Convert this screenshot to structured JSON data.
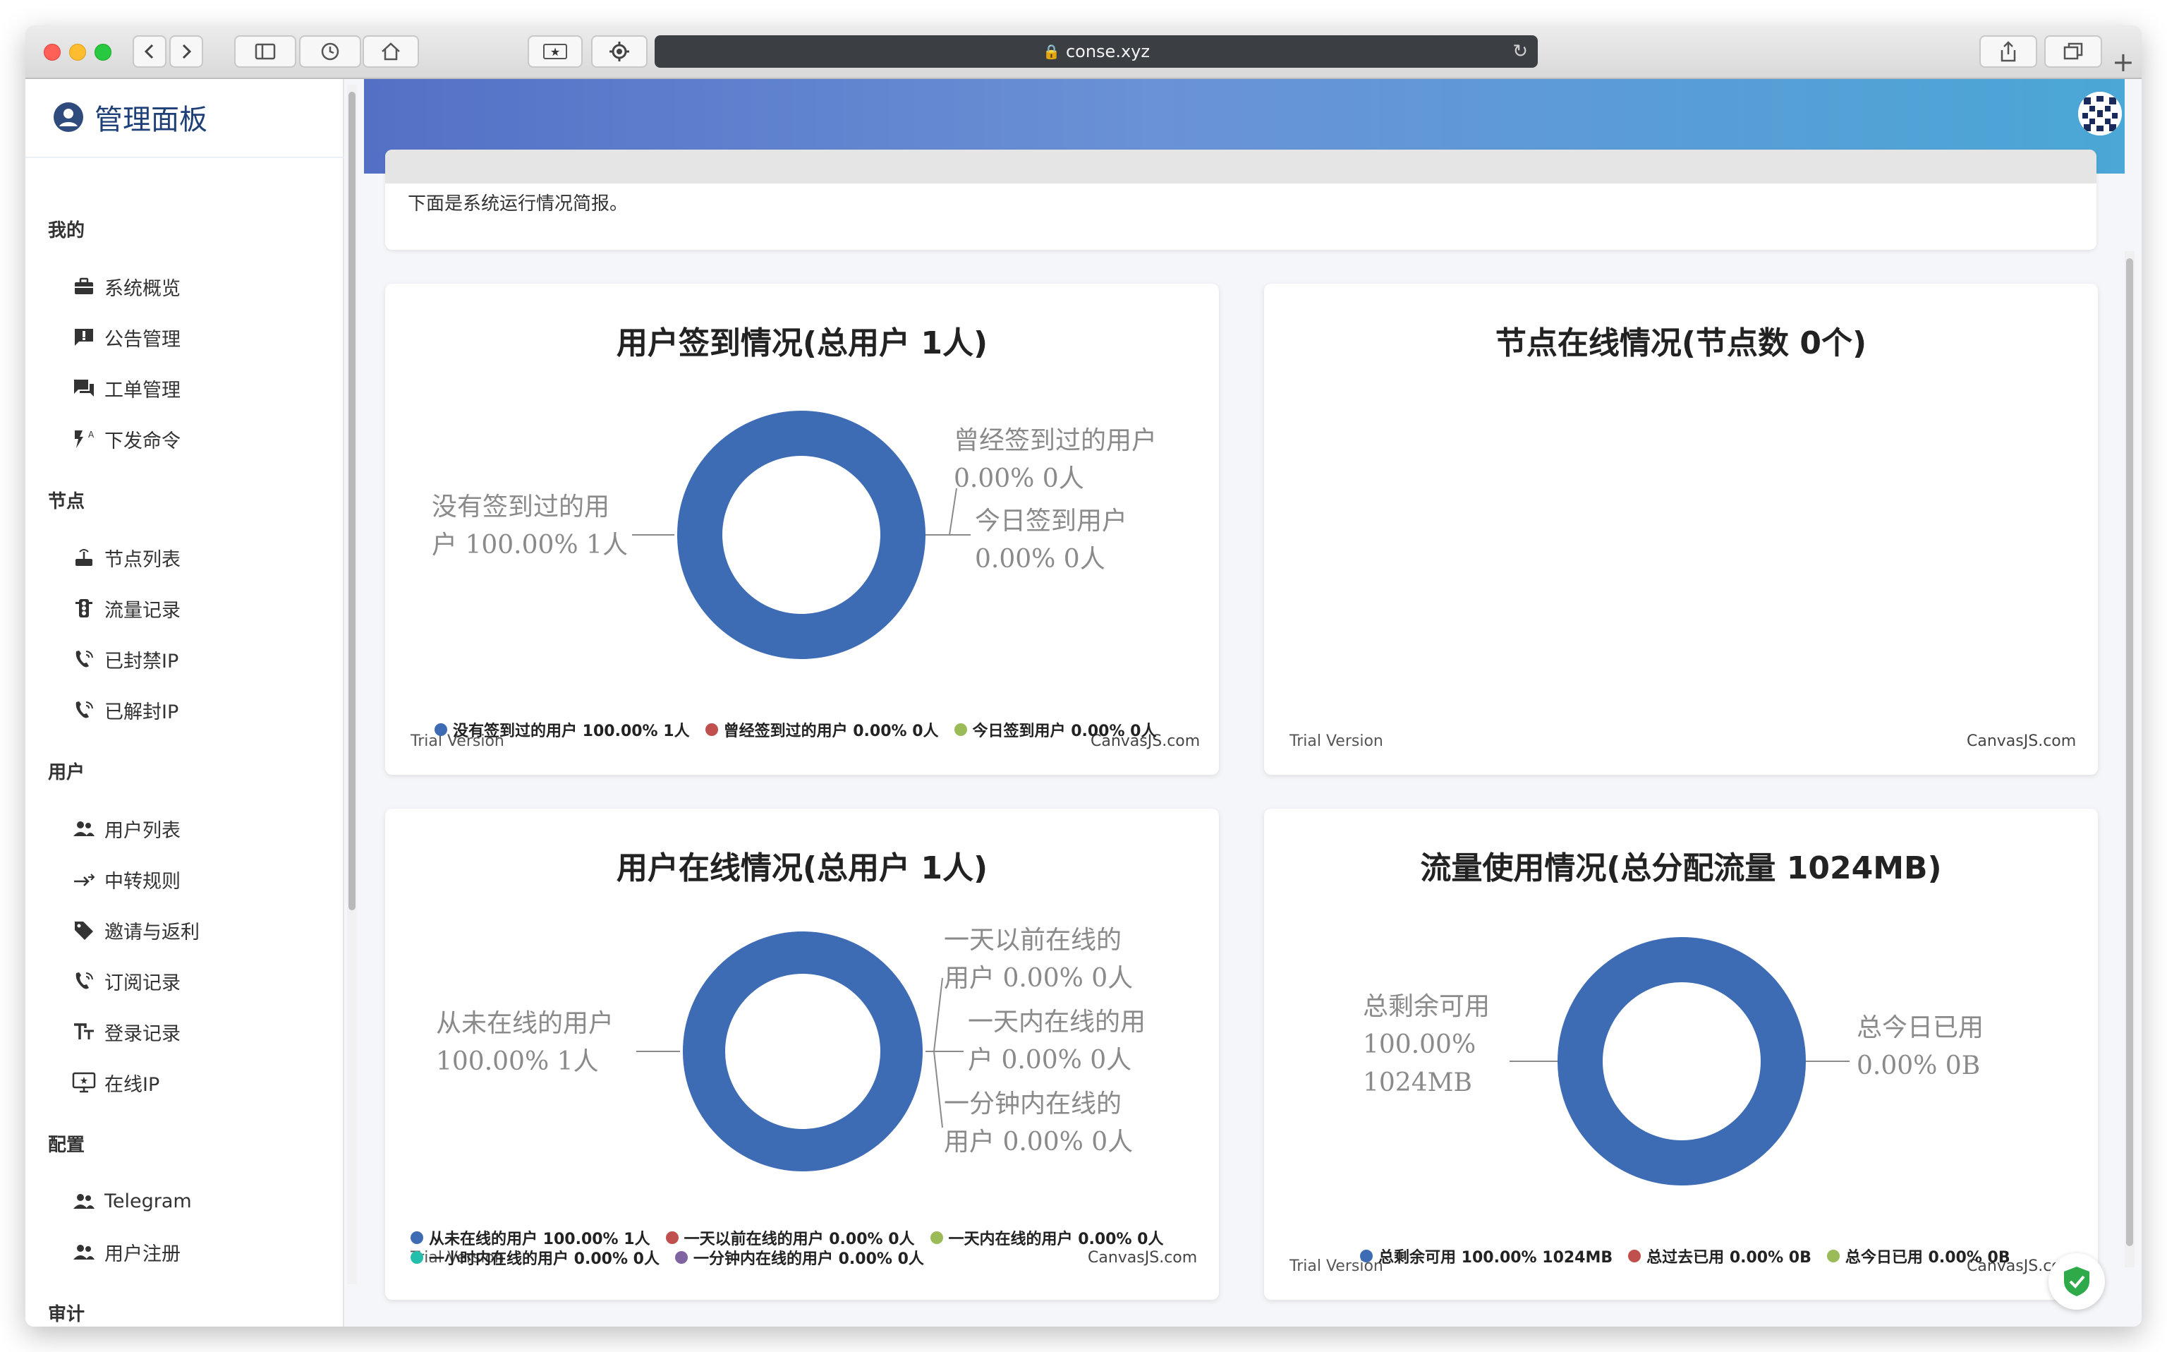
{
  "browser": {
    "url": "conse.xyz",
    "new_tab": "+"
  },
  "sidebar": {
    "title": "管理面板",
    "groups": [
      {
        "label": "我的",
        "items": [
          {
            "label": "系统概览",
            "icon": "dashboard-icon"
          },
          {
            "label": "公告管理",
            "icon": "announcement-icon"
          },
          {
            "label": "工单管理",
            "icon": "ticket-icon"
          },
          {
            "label": "下发命令",
            "icon": "command-icon"
          }
        ]
      },
      {
        "label": "节点",
        "items": [
          {
            "label": "节点列表",
            "icon": "router-icon"
          },
          {
            "label": "流量记录",
            "icon": "traffic-icon"
          },
          {
            "label": "已封禁IP",
            "icon": "phone-icon"
          },
          {
            "label": "已解封IP",
            "icon": "phone-icon"
          }
        ]
      },
      {
        "label": "用户",
        "items": [
          {
            "label": "用户列表",
            "icon": "people-icon"
          },
          {
            "label": "中转规则",
            "icon": "relay-icon"
          },
          {
            "label": "邀请与返利",
            "icon": "tag-icon"
          },
          {
            "label": "订阅记录",
            "icon": "phone-icon"
          },
          {
            "label": "登录记录",
            "icon": "text-icon"
          },
          {
            "label": "在线IP",
            "icon": "screen-icon"
          }
        ]
      },
      {
        "label": "配置",
        "items": [
          {
            "label": "Telegram",
            "icon": "people-icon"
          },
          {
            "label": "用户注册",
            "icon": "people-icon"
          }
        ]
      },
      {
        "label": "审计",
        "items": []
      }
    ]
  },
  "notice": {
    "text": "下面是系统运行情况简报。"
  },
  "charts_meta": {
    "trial": "Trial Version",
    "credit": "CanvasJS.com"
  },
  "chart_data": [
    {
      "type": "pie",
      "variant": "doughnut",
      "title": "用户签到情况(总用户 1人)",
      "slices": [
        {
          "name": "没有签到过的用户",
          "value": 100.0,
          "count_label": "1人",
          "label": "没有签到过的用户 100.00% 1人",
          "color": "#3e6cb4"
        },
        {
          "name": "曾经签到过的用户",
          "value": 0.0,
          "count_label": "0人",
          "label": "曾经签到过的用户 0.00% 0人",
          "color": "#c0504e"
        },
        {
          "name": "今日签到用户",
          "value": 0.0,
          "count_label": "0人",
          "label": "今日签到用户 0.00% 0人",
          "color": "#9bbb58"
        }
      ],
      "callouts": [
        "没有签到过的用",
        "户 100.00% 1人",
        "曾经签到过的用户",
        "0.00% 0人",
        "今日签到用户",
        "0.00% 0人"
      ],
      "legend": "bottom"
    },
    {
      "type": "pie",
      "variant": "doughnut",
      "title": "节点在线情况(节点数 0个)",
      "slices": [],
      "legend": "none"
    },
    {
      "type": "pie",
      "variant": "doughnut",
      "title": "用户在线情况(总用户 1人)",
      "slices": [
        {
          "name": "从未在线的用户",
          "value": 100.0,
          "label": "从未在线的用户 100.00% 1人",
          "color": "#3e6cb4"
        },
        {
          "name": "一天以前在线的用户",
          "value": 0.0,
          "label": "一天以前在线的用户 0.00% 0人",
          "color": "#c0504e"
        },
        {
          "name": "一天内在线的用户",
          "value": 0.0,
          "label": "一天内在线的用户 0.00% 0人",
          "color": "#9bbb58"
        },
        {
          "name": "一小时内在线的用户",
          "value": 0.0,
          "label": "一小时内在线的用户 0.00% 0人",
          "color": "#23bfaa"
        },
        {
          "name": "一分钟内在线的用户",
          "value": 0.0,
          "label": "一分钟内在线的用户 0.00% 0人",
          "color": "#8064a1"
        }
      ],
      "callouts": [
        "从未在线的用户",
        "100.00% 1人",
        "一天以前在线的",
        "用户 0.00% 0人",
        "一天内在线的用",
        "户 0.00% 0人",
        "一分钟内在线的",
        "用户 0.00% 0人"
      ],
      "legend": "bottom"
    },
    {
      "type": "pie",
      "variant": "doughnut",
      "title": "流量使用情况(总分配流量 1024MB)",
      "slices": [
        {
          "name": "总剩余可用",
          "value": 100.0,
          "label": "总剩余可用 100.00% 1024MB",
          "color": "#3e6cb4"
        },
        {
          "name": "总过去已用",
          "value": 0.0,
          "label": "总过去已用 0.00% 0B",
          "color": "#c0504e"
        },
        {
          "name": "总今日已用",
          "value": 0.0,
          "label": "总今日已用 0.00% 0B",
          "color": "#9bbb58"
        }
      ],
      "callouts": [
        "总剩余可用",
        "100.00%",
        "1024MB",
        "总今日已用",
        "0.00% 0B"
      ],
      "legend": "bottom"
    }
  ]
}
